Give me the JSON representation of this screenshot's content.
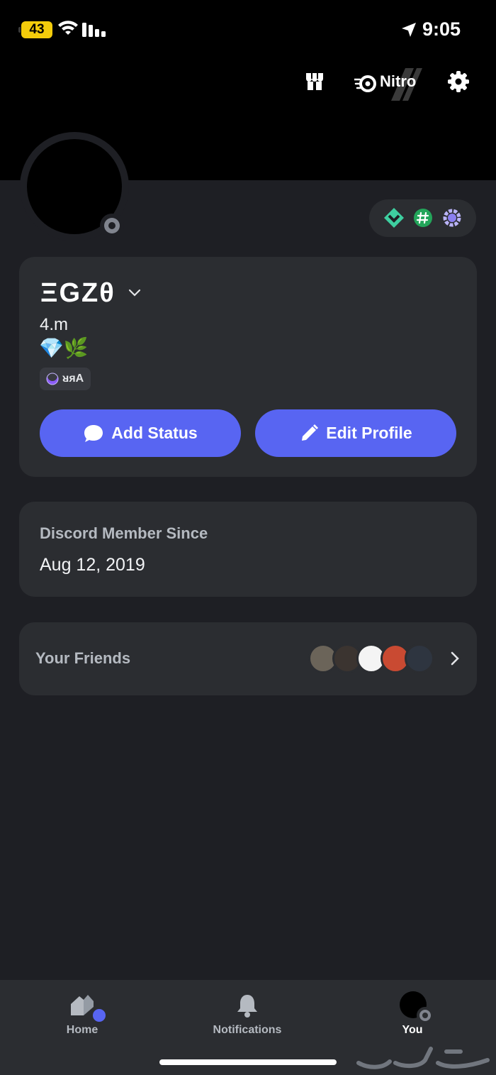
{
  "status_bar": {
    "battery": "43",
    "time": "9:05"
  },
  "header": {
    "nitro_label": "Nitro"
  },
  "profile": {
    "display_name": "ΞGZθ",
    "username": "4.m",
    "emojis": "💎🌿",
    "tag": "ᴚяA",
    "buttons": {
      "add_status": "Add Status",
      "edit_profile": "Edit Profile"
    }
  },
  "member": {
    "label": "Discord Member Since",
    "date": "Aug 12, 2019"
  },
  "friends": {
    "label": "Your Friends",
    "avatars": [
      "#6b6459",
      "#3b3430",
      "#f4f4f4",
      "#c94a32",
      "#2e3540"
    ]
  },
  "nav": {
    "home": "Home",
    "notifications": "Notifications",
    "you": "You"
  },
  "colors": {
    "accent": "#5865f2",
    "background": "#1e1f24",
    "card": "#2b2d31",
    "battery": "#f4cc0b"
  }
}
